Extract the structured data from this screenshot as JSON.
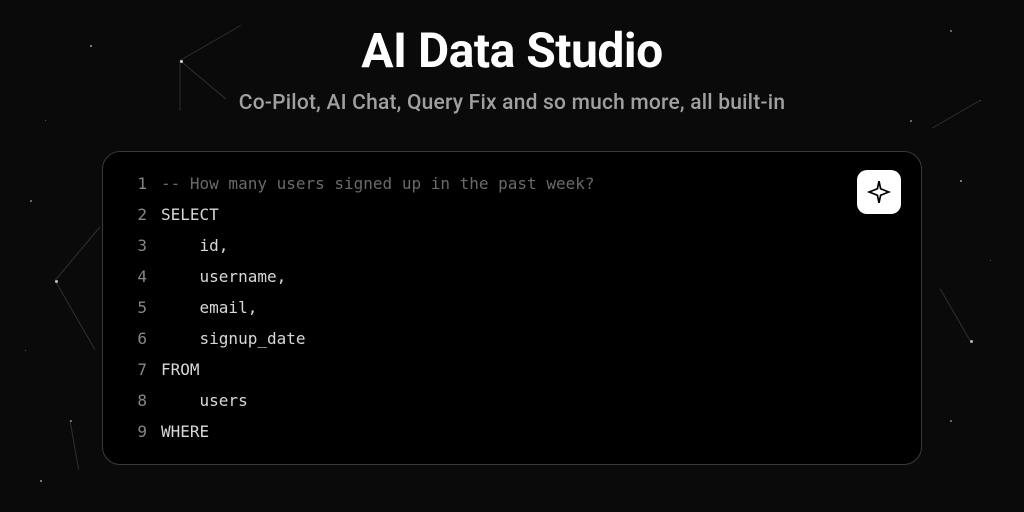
{
  "header": {
    "title": "AI Data Studio",
    "subtitle": "Co-Pilot, AI Chat, Query Fix and so much more, all built-in"
  },
  "editor": {
    "ai_button": "sparkle-icon",
    "lines": [
      {
        "num": "1",
        "text": "-- How many users signed up in the past week?",
        "indent": "",
        "type": "comment"
      },
      {
        "num": "2",
        "text": "SELECT",
        "indent": "",
        "type": "keyword"
      },
      {
        "num": "3",
        "text": "id,",
        "indent": "    ",
        "type": "code"
      },
      {
        "num": "4",
        "text": "username,",
        "indent": "    ",
        "type": "code"
      },
      {
        "num": "5",
        "text": "email,",
        "indent": "    ",
        "type": "code"
      },
      {
        "num": "6",
        "text": "signup_date",
        "indent": "    ",
        "type": "code"
      },
      {
        "num": "7",
        "text": "FROM",
        "indent": "",
        "type": "keyword"
      },
      {
        "num": "8",
        "text": "users",
        "indent": "    ",
        "type": "code"
      },
      {
        "num": "9",
        "text": "WHERE",
        "indent": "",
        "type": "keyword"
      }
    ]
  }
}
